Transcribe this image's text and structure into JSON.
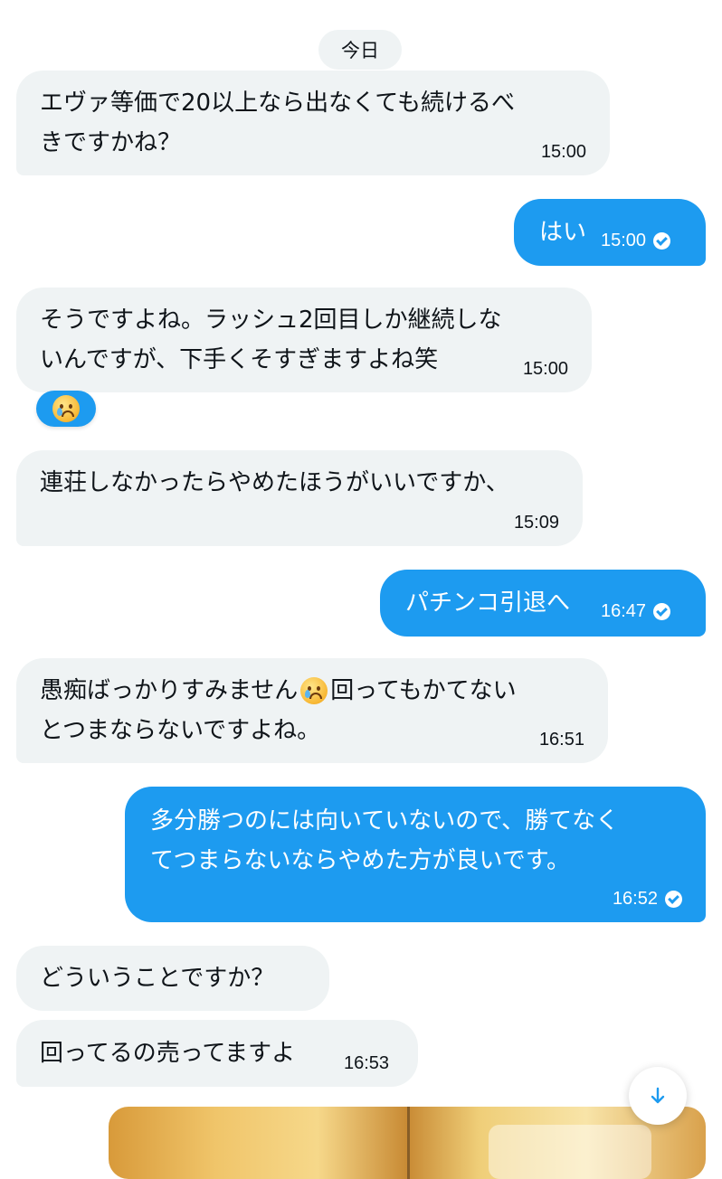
{
  "date_label": "今日",
  "messages": [
    {
      "direction": "in",
      "lines": [
        "エヴァ等価で20以上なら出なくても続けるべ",
        "きですかね？"
      ],
      "time": "15:00"
    },
    {
      "direction": "out",
      "lines": [
        "はい"
      ],
      "time": "15:00",
      "status": "sent-check"
    },
    {
      "direction": "in",
      "lines": [
        "そうですよね。ラッシュ2回目しか継続しな",
        "いんですが、下手くそすぎますよね笑"
      ],
      "time": "15:00",
      "reaction": "crying-face-emoji"
    },
    {
      "direction": "in",
      "lines": [
        "連荘しなかったらやめたほうがいいですか、"
      ],
      "time": "15:09"
    },
    {
      "direction": "out",
      "lines": [
        "パチンコ引退へ"
      ],
      "time": "16:47",
      "status": "sent-check"
    },
    {
      "direction": "in",
      "lines_parts": [
        [
          "愚痴ばっかりすみません",
          "回ってもかてない"
        ],
        "とつまならないですよね。"
      ],
      "emoji_inline": "crying-face-emoji",
      "time": "16:51"
    },
    {
      "direction": "out",
      "lines": [
        "多分勝つのには向いていないので、勝てなく",
        "てつまらないならやめた方が良いです。"
      ],
      "time": "16:52",
      "status": "sent-check"
    },
    {
      "direction": "in",
      "lines": [
        "どういうことですか？"
      ]
    },
    {
      "direction": "in",
      "lines": [
        "回ってるの売ってますよ"
      ],
      "time": "16:53"
    }
  ],
  "icons": {
    "sent_status": "check-circle-icon",
    "scroll_down": "arrow-down-icon"
  },
  "colors": {
    "incoming_bubble": "#eff3f4",
    "outgoing_bubble": "#1d9bf0",
    "accent": "#1d9bf0",
    "text": "#0f1419"
  }
}
